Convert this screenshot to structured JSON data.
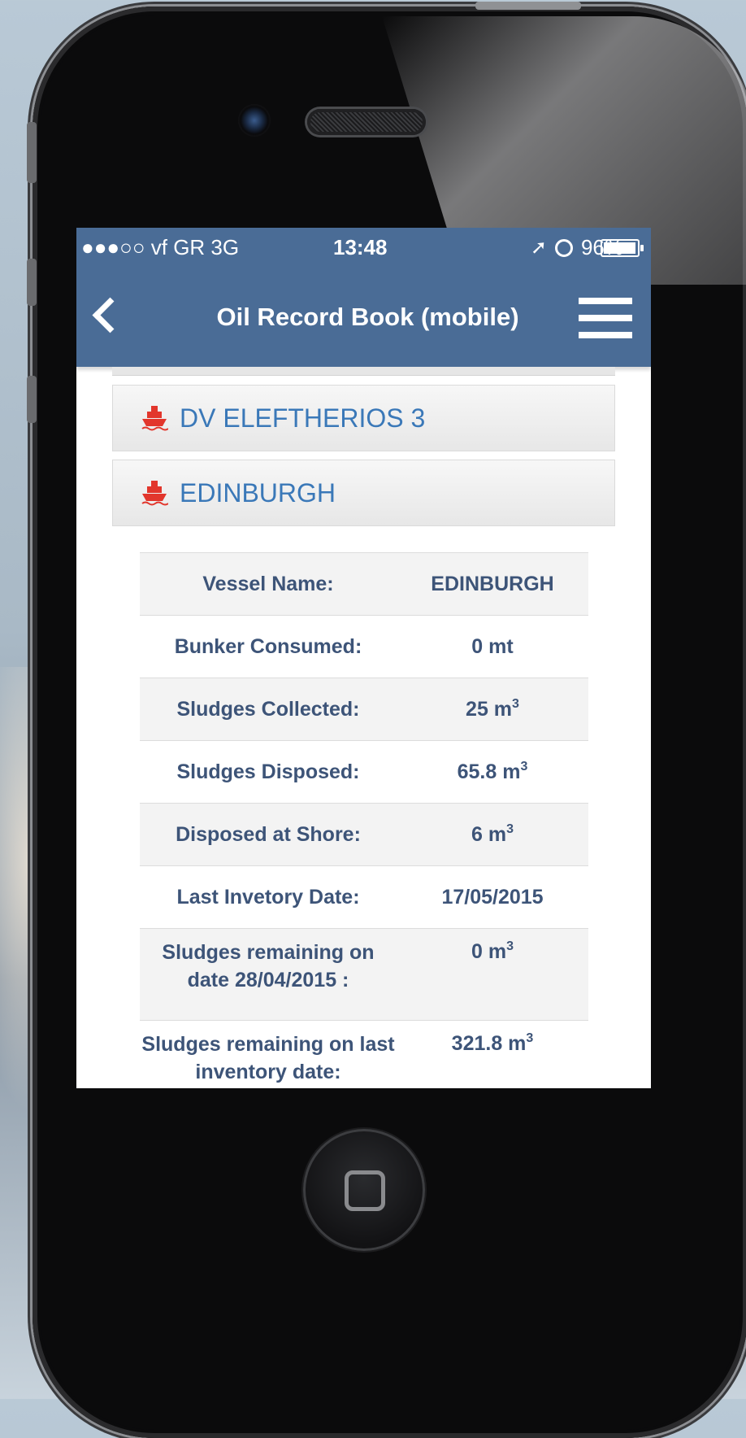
{
  "status_bar": {
    "carrier": "●●●○○ vf GR  3G",
    "time": "13:48",
    "battery": "96%"
  },
  "nav": {
    "title": "Oil Record Book (mobile)"
  },
  "vessels": [
    {
      "name": "DV ELEFTHERIOS 3"
    },
    {
      "name": "EDINBURGH"
    }
  ],
  "details": {
    "rows": [
      {
        "label": "Vessel Name:",
        "value": "EDINBURGH",
        "unit": ""
      },
      {
        "label": "Bunker Consumed:",
        "value": "0 mt",
        "unit": ""
      },
      {
        "label": "Sludges Collected:",
        "value": "25 m",
        "unit": "3"
      },
      {
        "label": "Sludges Disposed:",
        "value": "65.8 m",
        "unit": "3"
      },
      {
        "label": "Disposed at Shore:",
        "value": "6 m",
        "unit": "3"
      },
      {
        "label": "Last Invetory Date:",
        "value": "17/05/2015",
        "unit": ""
      },
      {
        "label": "Sludges remaining on date 28/04/2015 :",
        "value": "0 m",
        "unit": "3"
      },
      {
        "label": "Sludges remaining on last inventory date:",
        "value": "321.8 m",
        "unit": "3"
      }
    ]
  },
  "colors": {
    "header_blue": "#4a6c96",
    "vessel_link": "#3a78b8",
    "ship_icon": "#e2362c",
    "table_text": "#3d5478"
  }
}
